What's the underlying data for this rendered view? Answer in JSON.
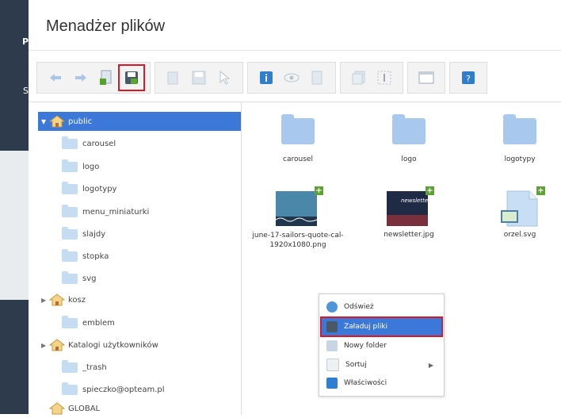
{
  "dialog": {
    "title": "Menadżer plików"
  },
  "background": {
    "label_p": "P",
    "label_s": "S"
  },
  "toolbar": {
    "buttons": [
      {
        "icon": "back-arrow-icon"
      },
      {
        "icon": "forward-arrow-icon"
      },
      {
        "icon": "new-file-icon"
      },
      {
        "icon": "upload-files-icon"
      },
      {
        "icon": "copy-icon"
      },
      {
        "icon": "save-icon"
      },
      {
        "icon": "cursor-icon"
      },
      {
        "icon": "info-icon"
      },
      {
        "icon": "preview-eye-icon"
      },
      {
        "icon": "document-icon"
      },
      {
        "icon": "pages-icon"
      },
      {
        "icon": "text-select-icon"
      },
      {
        "icon": "window-icon"
      },
      {
        "icon": "help-icon"
      }
    ]
  },
  "tree": {
    "root": "public",
    "children": [
      "carousel",
      "logo",
      "logotypy",
      "menu_miniaturki",
      "slajdy",
      "stopka",
      "svg"
    ],
    "kosz": "kosz",
    "emblem": "emblem",
    "katalogi": "Katalogi użytkowników",
    "trash": "_trash",
    "user": "spieczko@opteam.pl",
    "global": "GLOBAL"
  },
  "files": {
    "folders": [
      "carousel",
      "logo",
      "logotypy"
    ],
    "images": [
      {
        "name": "june-17-sailors-quote-cal-1920x1080.png"
      },
      {
        "name": "newsletter.jpg",
        "thumb_text": "newslette"
      },
      {
        "name": "orzel.svg"
      }
    ]
  },
  "context_menu": {
    "items": [
      "Odśwież",
      "Załaduj pliki",
      "Nowy folder",
      "Sortuj",
      "Właściwości"
    ]
  },
  "colors": {
    "selection": "#3c78d8",
    "highlight": "#d7192a",
    "folder": "#a8c8ee"
  }
}
